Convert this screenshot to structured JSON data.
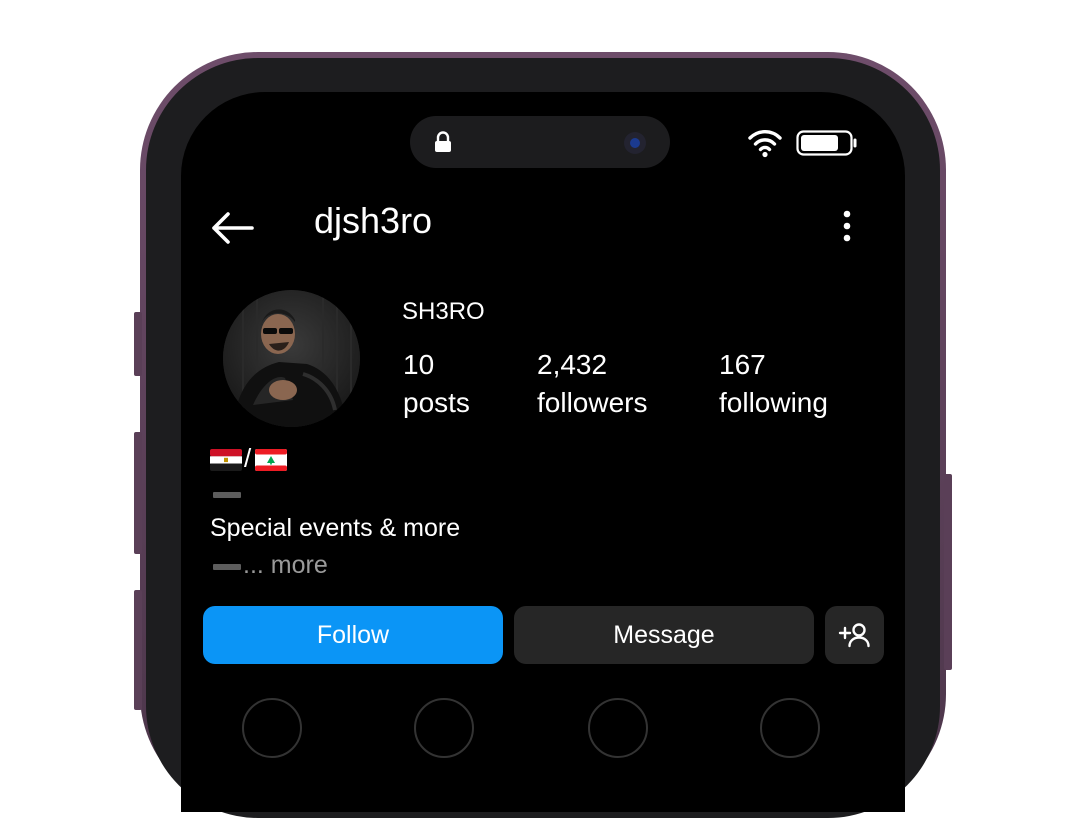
{
  "status_bar": {
    "icons": [
      "lock-icon",
      "camera",
      "wifi-icon",
      "battery-icon"
    ]
  },
  "header": {
    "username": "djsh3ro",
    "back_icon": "arrow-left",
    "menu_icon": "vertical-ellipsis"
  },
  "profile": {
    "display_name": "SH3RO",
    "stats": [
      {
        "value": "10",
        "label": "posts"
      },
      {
        "value": "2,432",
        "label": "followers"
      },
      {
        "value": "167",
        "label": "following"
      }
    ],
    "bio": {
      "flags_separator": "/",
      "line": "Special events & more",
      "more": "... more"
    }
  },
  "actions": {
    "follow_label": "Follow",
    "message_label": "Message",
    "add_user_icon": "person-plus"
  },
  "colors": {
    "follow_blue": "#0b95f6",
    "button_dark": "#262626",
    "frame_purple": "#5a3f57"
  }
}
